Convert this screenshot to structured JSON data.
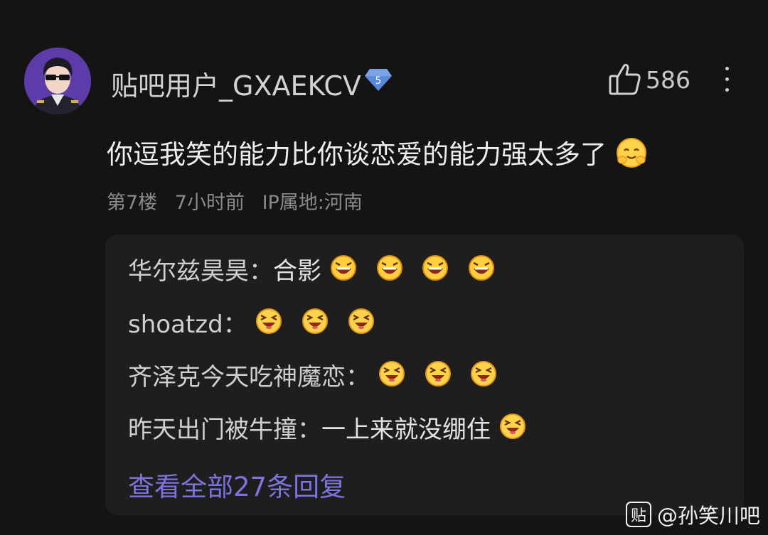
{
  "post": {
    "username": "贴吧用户_GXAEKCV",
    "level_badge": "5",
    "like_count": "586",
    "comment_text": "你逗我笑的能力比你谈恋爱的能力强太多了",
    "comment_emoji": "blushing-smile-emoji",
    "floor": "第7楼",
    "time": "7小时前",
    "ip_location": "IP属地:河南"
  },
  "replies": [
    {
      "name": "华尔兹昊昊：",
      "text": "合影",
      "emoji": "laughing-open-mouth-emoji",
      "emoji_count": 4
    },
    {
      "name": "shoatzd：",
      "text": "",
      "emoji": "squinting-laugh-emoji",
      "emoji_count": 3
    },
    {
      "name": "齐泽克今天吃神魔恋：",
      "text": "",
      "emoji": "squinting-laugh-emoji",
      "emoji_count": 3
    },
    {
      "name": "昨天出门被牛撞：",
      "text": "一上来就没绷住",
      "emoji": "squinting-laugh-emoji",
      "emoji_count": 1
    }
  ],
  "view_all_replies": "查看全部27条回复",
  "watermark": {
    "icon_text": "贴",
    "handle": "@孙笑川吧"
  },
  "colors": {
    "background": "#141414",
    "reply_box": "#1f1e1f",
    "link": "#7c73e0",
    "badge": "#5b8ad9"
  }
}
